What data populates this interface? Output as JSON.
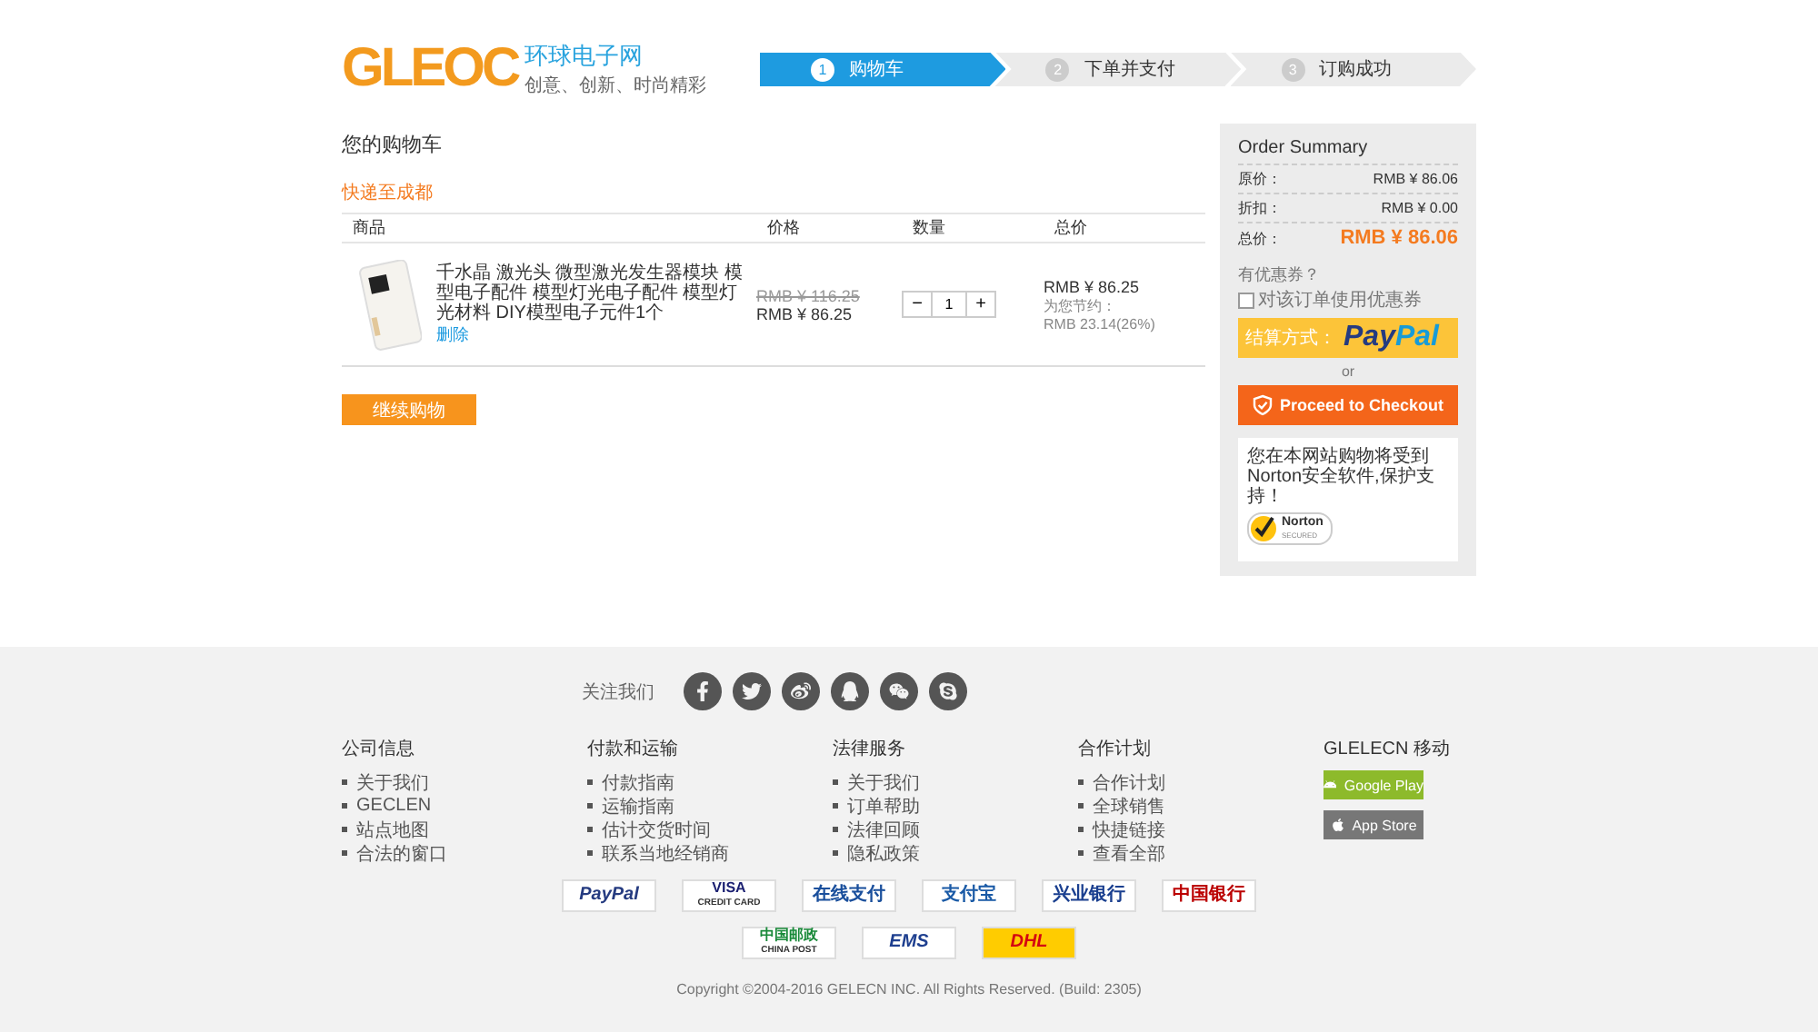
{
  "logo": {
    "mark": "GLEOC",
    "name": "环球电子网",
    "slogan": "创意、创新、时尚精彩"
  },
  "steps": [
    {
      "number": "1",
      "label": "购物车",
      "selected": true
    },
    {
      "number": "2",
      "label": "下单并支付",
      "selected": false
    },
    {
      "number": "3",
      "label": "订购成功",
      "selected": false
    }
  ],
  "cart": {
    "title": "您的购物车",
    "shipping": "快递至成都",
    "columns": [
      "商品",
      "价格",
      "数量",
      "总价"
    ],
    "items": [
      {
        "title": "千水晶 激光头 微型激光发生器模块 模型电子配件 模型灯光电子配件 模型灯光材料 DIY模型电子元件1个",
        "remove": "删除",
        "old_price": "RMB ¥ 116.25",
        "price": "RMB ¥ 86.25",
        "quantity": "1",
        "minus": "−",
        "plus": "+",
        "total": "RMB ¥ 86.25",
        "savings_label": "为您节约：",
        "savings": "RMB 23.14(26%)"
      }
    ],
    "continue": "继续购物"
  },
  "summary": {
    "title": "Order Summary",
    "rows": [
      {
        "label": "原价：",
        "value": "RMB ¥ 86.06",
        "kind": "plain"
      },
      {
        "label": "折扣：",
        "value": "RMB ¥ 0.00",
        "kind": "plain"
      },
      {
        "label": "总价：",
        "value": "RMB ¥ 86.06",
        "kind": "total"
      }
    ],
    "coupon_question": "有优惠券？",
    "coupon_option": {
      "label": "对该订单使用优惠券",
      "checked": false
    },
    "paypal": {
      "label": "结算方式：",
      "brand_a": "Pay",
      "brand_b": "Pal"
    },
    "or": "or",
    "checkout": "Proceed to Checkout",
    "norton_text": "您在本网站购物将受到Norton安全软件,保护支持！",
    "norton_name": "Norton",
    "norton_sub": "SECURED"
  },
  "footer": {
    "follow": "关注我们",
    "social": [
      {
        "kind": "facebook"
      },
      {
        "kind": "twitter"
      },
      {
        "kind": "weibo"
      },
      {
        "kind": "qq"
      },
      {
        "kind": "wechat"
      },
      {
        "kind": "skype"
      }
    ],
    "columns": [
      {
        "title": "公司信息",
        "links": [
          "关于我们",
          "GECLEN",
          "站点地图",
          "合法的窗口"
        ]
      },
      {
        "title": "付款和运输",
        "links": [
          "付款指南",
          "运输指南",
          "估计交货时间",
          "联系当地经销商"
        ]
      },
      {
        "title": "法律服务",
        "links": [
          "关于我们",
          "订单帮助",
          "法律回顾",
          "隐私政策"
        ]
      },
      {
        "title": "合作计划",
        "links": [
          "合作计划",
          "全球销售",
          "快捷链接",
          "查看全部"
        ]
      }
    ],
    "mobile": {
      "title": "GLELECN 移动",
      "apps": [
        {
          "label": "Google Play",
          "kind": "android"
        },
        {
          "label": "App Store",
          "kind": "apple"
        }
      ]
    },
    "payment_logos": [
      [
        {
          "label": "PayPal",
          "kind": "paypal"
        },
        {
          "label": "VISA",
          "sub": "CREDIT CARD",
          "kind": "visa"
        },
        {
          "label": "在线支付",
          "kind": "unionpay"
        },
        {
          "label": "支付宝",
          "kind": "alipay"
        },
        {
          "label": "兴业银行",
          "kind": "bank"
        },
        {
          "label": "中国银行",
          "kind": "boc"
        }
      ],
      [
        {
          "label": "中国邮政",
          "sub": "CHINA POST",
          "kind": "post"
        },
        {
          "label": "EMS",
          "kind": "ems"
        },
        {
          "label": "DHL",
          "kind": "dhl"
        }
      ]
    ],
    "copyright": "Copyright ©2004-2016 GELECN INC. All Rights Reserved. (Build: 2305)"
  }
}
